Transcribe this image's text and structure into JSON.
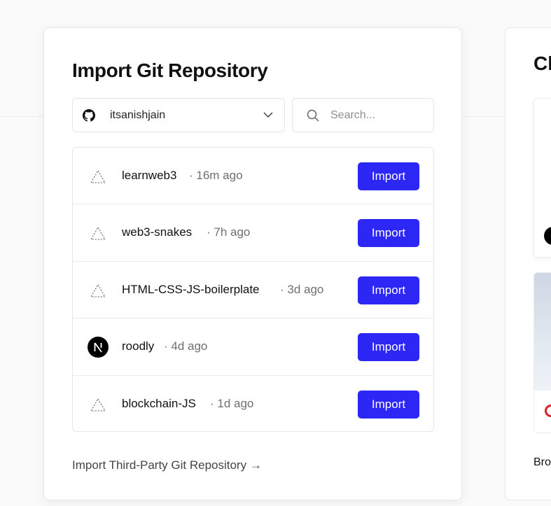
{
  "import_panel": {
    "title": "Import Git Repository",
    "account": "itsanishjain",
    "search_placeholder": "Search...",
    "repos": [
      {
        "name": "learnweb3",
        "age": "16m ago",
        "icon": "triangle-icon",
        "action": "Import"
      },
      {
        "name": "web3-snakes",
        "age": "7h ago",
        "icon": "triangle-icon",
        "action": "Import"
      },
      {
        "name": "HTML-CSS-JS-boilerplate",
        "age": "3d ago",
        "icon": "triangle-icon",
        "action": "Import"
      },
      {
        "name": "roodly",
        "age": "4d ago",
        "icon": "nextjs-icon",
        "action": "Import"
      },
      {
        "name": "blockchain-JS",
        "age": "1d ago",
        "icon": "triangle-icon",
        "action": "Import"
      }
    ],
    "third_party_link": "Import Third-Party Git Repository →"
  },
  "side_panel": {
    "title_partial": "Cl",
    "bottom_text_partial": "Bro"
  },
  "colors": {
    "accent": "#2d27f5",
    "muted_text": "#6f6f6f"
  }
}
